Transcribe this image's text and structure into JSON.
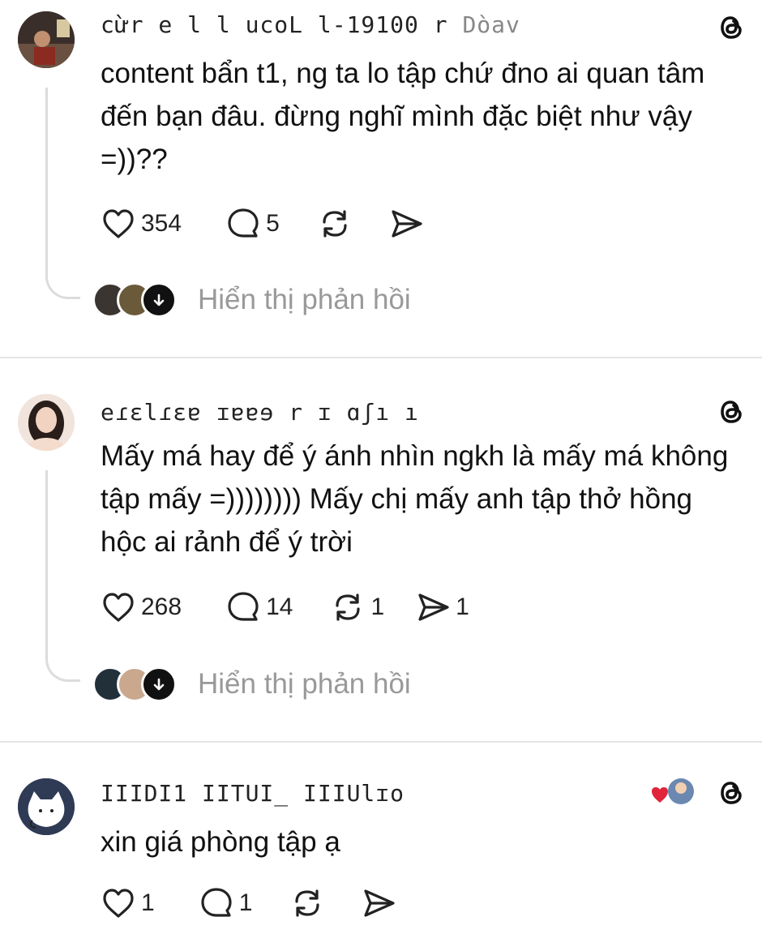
{
  "posts": [
    {
      "username": "cừr e l l ucoL l-19100 r",
      "username_faint": "Dòav",
      "content": "content bẩn t1, ng ta lo tập chứ đno ai quan tâm đến bạn đâu. đừng nghĩ mình đặc biệt như vậy =))??",
      "likes": "354",
      "comments": "5",
      "reposts": "",
      "shares": "",
      "show_replies_label": "Hiển thị phản hồi"
    },
    {
      "username": "eɾɛlɾɛɐ ɪɐɐɘ r ɪ ɑʃı ı",
      "username_faint": "",
      "content": "Mấy má hay để ý ánh nhìn ngkh là mấy má không tập mấy =)))))))) Mấy chị mấy anh tập thở hồng hộc ai rảnh để ý trời",
      "likes": "268",
      "comments": "14",
      "reposts": "1",
      "shares": "1",
      "show_replies_label": "Hiển thị phản hồi"
    },
    {
      "username": "IIIDI1 IITUI_ IIIUlɪo",
      "username_faint": "",
      "content": "xin giá phòng tập ạ",
      "likes": "1",
      "comments": "1",
      "reposts": "",
      "shares": ""
    }
  ],
  "icons": {
    "threads": "threads-logo-icon",
    "like": "heart-icon",
    "comment": "comment-bubble-icon",
    "repost": "repost-icon",
    "share": "send-icon",
    "expand": "arrow-down-icon"
  },
  "colors": {
    "text": "#111111",
    "muted": "#999999",
    "line": "#dcdcdc",
    "reaction_heart": "#e0243a"
  }
}
